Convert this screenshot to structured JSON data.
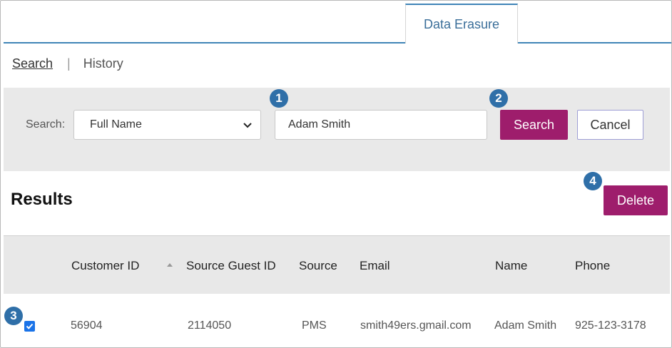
{
  "tabs": {
    "active_label": "Data Erasure"
  },
  "subnav": {
    "search_label": "Search",
    "separator": "|",
    "history_label": "History"
  },
  "search": {
    "label": "Search:",
    "field_selected": "Full Name",
    "query_value": "Adam Smith",
    "search_button": "Search",
    "cancel_button": "Cancel"
  },
  "badges": {
    "b1": "1",
    "b2": "2",
    "b3": "3",
    "b4": "4"
  },
  "results": {
    "title": "Results",
    "delete_button": "Delete",
    "columns": [
      "Customer ID",
      "Source Guest ID",
      "Source",
      "Email",
      "Name",
      "Phone"
    ],
    "rows": [
      {
        "checked": true,
        "customer_id": "56904",
        "source_guest_id": "2114050",
        "source": "PMS",
        "email": "smith49ers.gmail.com",
        "name": "Adam Smith",
        "phone": "925-123-3178"
      }
    ]
  },
  "colors": {
    "accent": "#9e1d6c",
    "tab_blue": "#3f84b7",
    "badge": "#2f6fa8",
    "panel": "#e9e9e9"
  },
  "icons": {
    "select_chevron": "chevron-down-icon",
    "sort": "sort-up-icon",
    "check": "check-icon"
  }
}
